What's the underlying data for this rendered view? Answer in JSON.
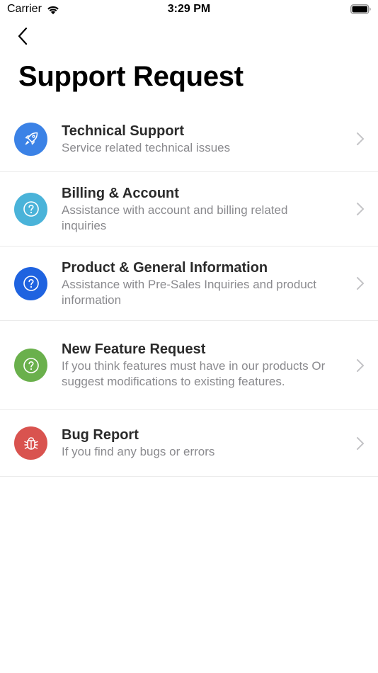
{
  "status_bar": {
    "carrier": "Carrier",
    "time": "3:29 PM"
  },
  "page": {
    "title": "Support Request"
  },
  "items": [
    {
      "title": "Technical Support",
      "subtitle": "Service related technical issues",
      "icon": "rocket-icon",
      "color": "#3b82e6"
    },
    {
      "title": "Billing & Account",
      "subtitle": "Assistance with account and billing related inquiries",
      "icon": "question-icon",
      "color": "#4ab3d9"
    },
    {
      "title": "Product & General Information",
      "subtitle": "Assistance with Pre-Sales Inquiries and product information",
      "icon": "question-icon",
      "color": "#1f63e0"
    },
    {
      "title": "New Feature Request",
      "subtitle": "If you think features must have in our products Or suggest modifications to existing features.",
      "icon": "question-icon",
      "color": "#6ab04c"
    },
    {
      "title": "Bug Report",
      "subtitle": "If you find any bugs or errors",
      "icon": "bug-icon",
      "color": "#d9534f"
    }
  ]
}
